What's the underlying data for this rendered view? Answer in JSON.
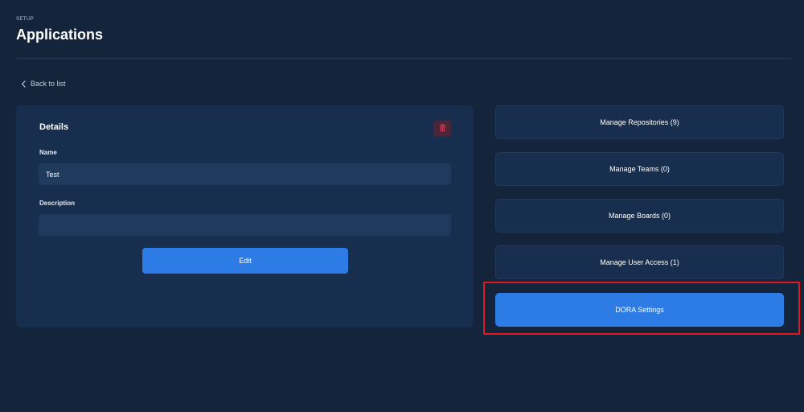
{
  "header": {
    "eyebrow": "SETUP",
    "title": "Applications"
  },
  "back_link": {
    "label": "Back to list",
    "icon": "chevron-left-icon"
  },
  "details": {
    "title": "Details",
    "delete_icon": "trash-icon",
    "name_label": "Name",
    "name_value": "Test",
    "description_label": "Description",
    "description_value": "",
    "edit_label": "Edit"
  },
  "actions": [
    {
      "label": "Manage Repositories (9)"
    },
    {
      "label": "Manage Teams (0)"
    },
    {
      "label": "Manage Boards (0)"
    },
    {
      "label": "Manage User Access (1)"
    },
    {
      "label": "DORA Settings"
    }
  ],
  "colors": {
    "background": "#13243b",
    "card": "#172e4e",
    "input": "#1f3a5d",
    "primary": "#2d7be5",
    "delete_bg": "#4a2637",
    "delete_icon": "#c33a52",
    "highlight": "#e0181f"
  }
}
